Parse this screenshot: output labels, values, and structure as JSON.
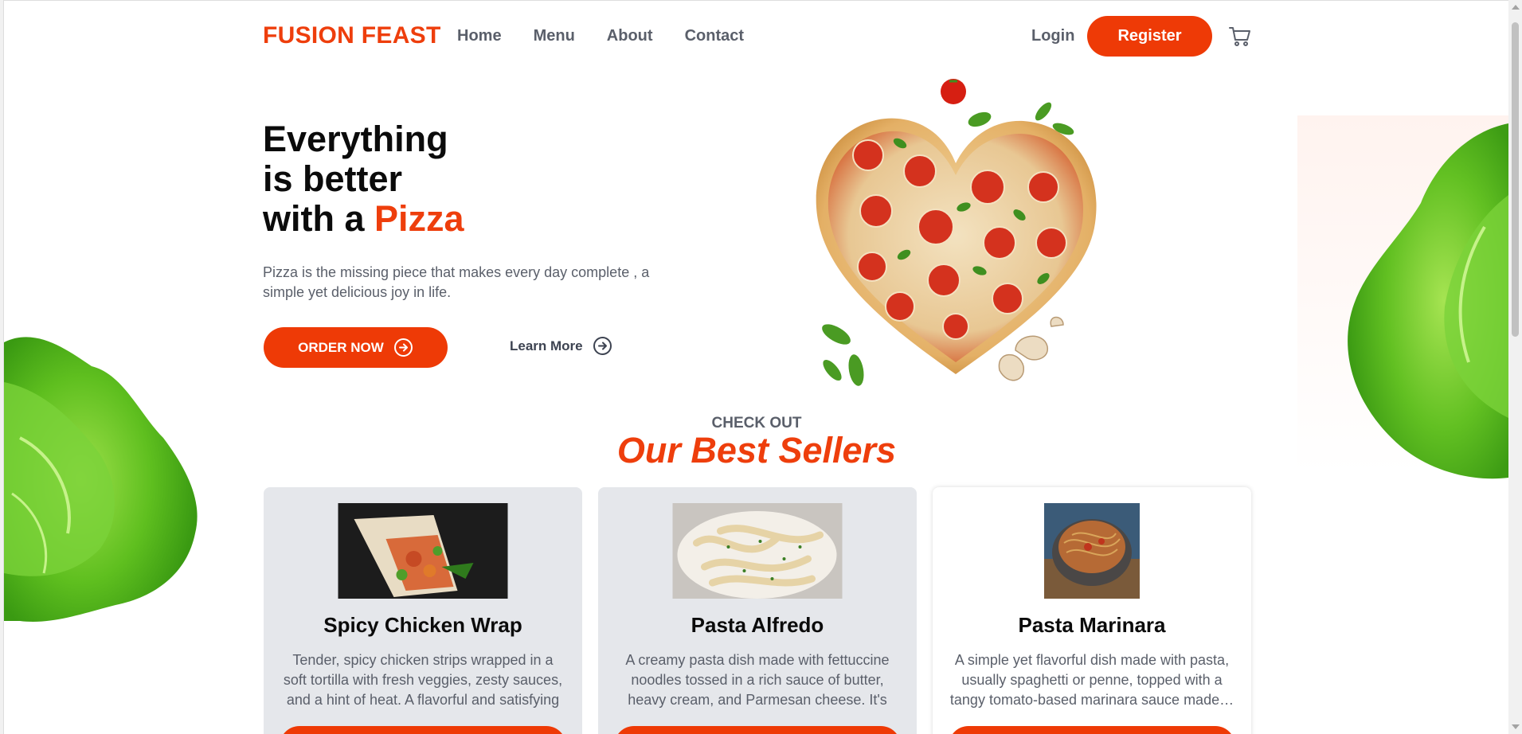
{
  "nav": {
    "logo": "FUSION FEAST",
    "links": [
      "Home",
      "Menu",
      "About",
      "Contact"
    ],
    "login": "Login",
    "register": "Register",
    "cart_icon": "cart-icon"
  },
  "hero": {
    "title_line1": "Everything",
    "title_line2": "is better",
    "title_line3_prefix": "with a",
    "title_accent": "Pizza",
    "description": "Pizza is the missing piece that makes every day complete , a simple yet delicious joy in life.",
    "order_button": "ORDER NOW",
    "learn_more": "Learn More"
  },
  "best_sellers": {
    "kicker": "CHECK OUT",
    "heading": "Our Best Sellers",
    "items": [
      {
        "name": "Spicy Chicken Wrap",
        "description": "Tender, spicy chicken strips wrapped in a soft tortilla with fresh veggies, zesty sauces, and a hint of heat. A flavorful and satisfying wrap…"
      },
      {
        "name": "Pasta Alfredo",
        "description": "A creamy pasta dish made with fettuccine noodles tossed in a rich sauce of butter, heavy cream, and Parmesan cheese. It's indulgent…"
      },
      {
        "name": "Pasta Marinara",
        "description": "A simple yet flavorful dish made with pasta, usually spaghetti or penne, topped with a tangy tomato-based marinara sauce made…"
      }
    ]
  },
  "colors": {
    "accent": "#ee3a06",
    "text_muted": "#5a5f6a",
    "card_grey": "#e5e7eb"
  }
}
